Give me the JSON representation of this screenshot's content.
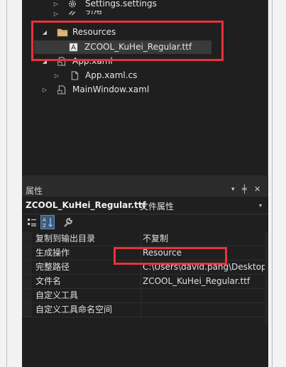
{
  "tree": {
    "settings_item": "Settings.settings",
    "references_item": "引用",
    "resources_folder": "Resources",
    "font_file": "ZCOOL_KuHei_Regular.ttf",
    "app_xaml": "App.xaml",
    "app_xaml_cs": "App.xaml.cs",
    "mainwindow_xaml": "MainWindow.xaml"
  },
  "properties": {
    "title": "属性",
    "pin": "╪",
    "close": "✕",
    "dropdown": "▾",
    "object_name": "ZCOOL_KuHei_Regular.ttf",
    "object_type": "文件属性",
    "rows": [
      {
        "name": "复制到输出目录",
        "value": "不复制"
      },
      {
        "name": "生成操作",
        "value": "Resource"
      },
      {
        "name": "完整路径",
        "value": "C:\\Users\\david.pang\\Desktop\\"
      },
      {
        "name": "文件名",
        "value": "ZCOOL_KuHei_Regular.ttf"
      },
      {
        "name": "自定义工具",
        "value": ""
      },
      {
        "name": "自定义工具命名空间",
        "value": ""
      }
    ]
  },
  "colors": {
    "highlight": "#e8323c",
    "folder": "#dcb67a",
    "background": "#1f1f1f"
  }
}
